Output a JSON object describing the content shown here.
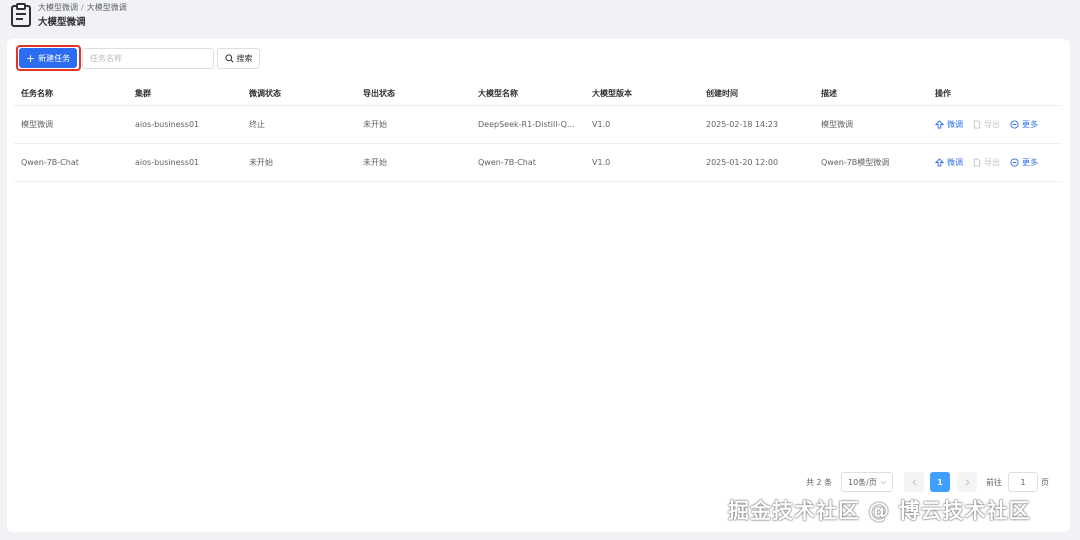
{
  "header": {
    "breadcrumb": [
      "大模型微调",
      "大模型微调"
    ],
    "breadcrumb_separator": "/",
    "title": "大模型微调",
    "icon": "clipboard-icon"
  },
  "toolbar": {
    "new_task_label": "新建任务",
    "search_placeholder": "任务名称",
    "search_value": "",
    "search_button_label": "搜索"
  },
  "table": {
    "columns": [
      "任务名称",
      "集群",
      "微调状态",
      "导出状态",
      "大模型名称",
      "大模型版本",
      "创建时间",
      "描述",
      "操作"
    ],
    "rows": [
      {
        "task_name": "模型微调",
        "cluster": "aios-business01",
        "finetune_status": "终止",
        "export_status": "未开始",
        "model_name": "DeepSeek-R1-Distill-Qwen...",
        "model_version": "V1.0",
        "created_at": "2025-02-18 14:23",
        "description": "模型微调",
        "actions": [
          "微调",
          "导出",
          "更多"
        ]
      },
      {
        "task_name": "Qwen-7B-Chat",
        "cluster": "aios-business01",
        "finetune_status": "未开始",
        "export_status": "未开始",
        "model_name": "Qwen-7B-Chat",
        "model_version": "V1.0",
        "created_at": "2025-01-20 12:00",
        "description": "Qwen-7B模型微调",
        "actions": [
          "微调",
          "导出",
          "更多"
        ]
      }
    ]
  },
  "pagination": {
    "total_text": "共 2 条",
    "page_size": "10条/页",
    "current_page": "1",
    "goto_label": "前往",
    "goto_value": "1",
    "page_unit": "页"
  },
  "watermark": "掘金技术社区 @ 博云技术社区",
  "colors": {
    "primary": "#2b6cf0",
    "danger": "#e0342a",
    "highlight_border": "#e0342a",
    "page_active": "#409eff"
  }
}
